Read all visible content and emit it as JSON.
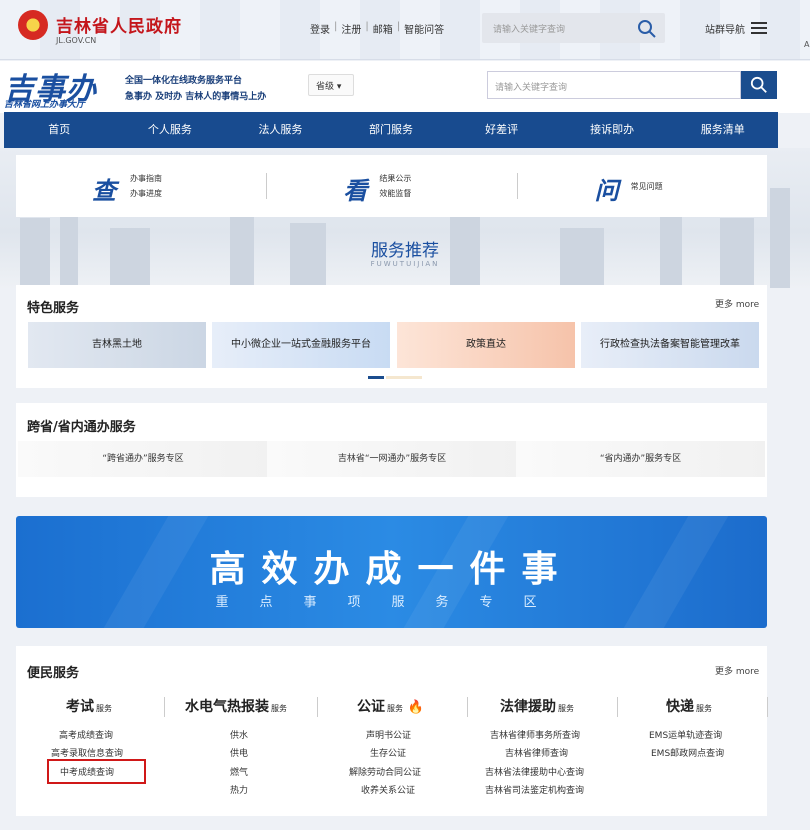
{
  "gov": {
    "name": "吉林省人民政府",
    "domain": "JL.GOV.CN"
  },
  "top_links": [
    "登录",
    "注册",
    "邮箱",
    "智能问答"
  ],
  "top_search": {
    "placeholder": "请输入关键字查询"
  },
  "site_nav": "站群导航",
  "edge_text": "A",
  "brand": {
    "logo": "吉事办",
    "logo_sub": "吉林省网上办事大厅",
    "slogan1": "全国一体化在线政务服务平台",
    "slogan2": "急事办 及时办 吉林人的事情马上办",
    "level": "省级"
  },
  "main_search": {
    "placeholder": "请输入关键字查询"
  },
  "nav": [
    "首页",
    "个人服务",
    "法人服务",
    "部门服务",
    "好差评",
    "接诉即办",
    "服务清单"
  ],
  "quick": [
    {
      "big": "查",
      "l1": "办事指南",
      "l2": "办事进度"
    },
    {
      "big": "看",
      "l1": "结果公示",
      "l2": "效能监督"
    },
    {
      "big": "问",
      "l1": "常见问题",
      "l2": ""
    }
  ],
  "recommend": {
    "title": "服务推荐",
    "subtitle": "FUWUTUIJIAN"
  },
  "featured": {
    "title": "特色服务",
    "more": "更多 more",
    "cards": [
      "吉林黑土地",
      "中小微企业一站式金融服务平台",
      "政策直达",
      "行政检查执法备案智能管理改革"
    ]
  },
  "cross": {
    "title": "跨省/省内通办服务",
    "buttons": [
      "“跨省通办”服务专区",
      "吉林省“一网通办”服务专区",
      "“省内通办”服务专区"
    ]
  },
  "banner": {
    "title": "高效办成一件事",
    "subtitle": "重点事项服务专区"
  },
  "convenience": {
    "title": "便民服务",
    "more": "更多 more",
    "categories": [
      {
        "name": "考试",
        "tag": "服务",
        "items": [
          "高考成绩查询",
          "高考录取信息查询",
          "中考成绩查询"
        ]
      },
      {
        "name": "水电气热报装",
        "tag": "服务",
        "items": [
          "供水",
          "供电",
          "燃气",
          "热力"
        ]
      },
      {
        "name": "公证",
        "tag": "服务",
        "items": [
          "声明书公证",
          "生存公证",
          "解除劳动合同公证",
          "收养关系公证"
        ]
      },
      {
        "name": "法律援助",
        "tag": "服务",
        "items": [
          "吉林省律师事务所查询",
          "吉林省律师查询",
          "吉林省法律援助中心查询",
          "吉林省司法鉴定机构查询"
        ]
      },
      {
        "name": "快递",
        "tag": "服务",
        "items": [
          "EMS运单轨迹查询",
          "EMS邮政网点查询"
        ]
      }
    ]
  },
  "colors": {
    "brand_blue": "#184b8f",
    "gov_red": "#c4161c",
    "highlight_red": "#d01818"
  }
}
